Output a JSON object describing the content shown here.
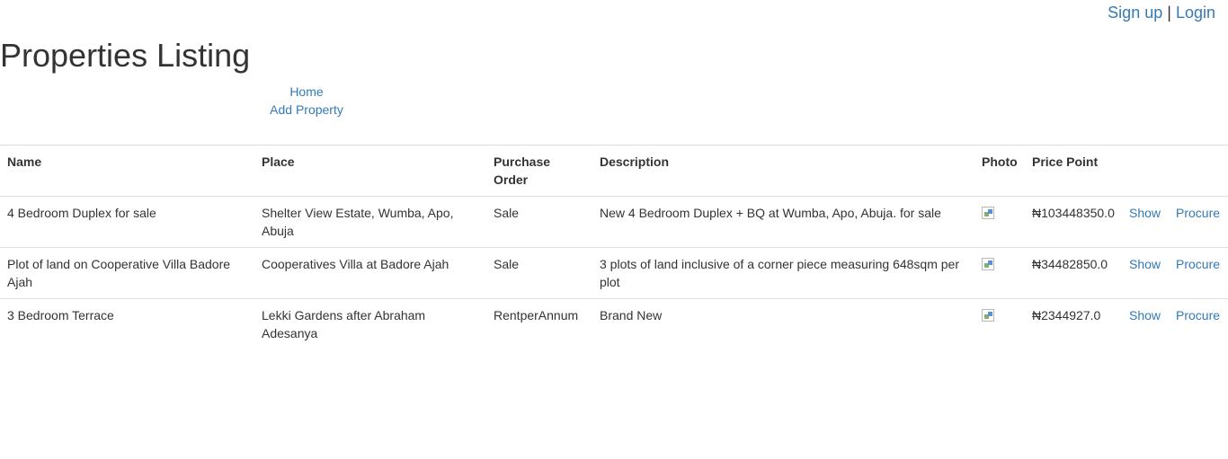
{
  "auth": {
    "signup": "Sign up",
    "separator": "|",
    "login": "Login"
  },
  "page_title": "Properties Listing",
  "nav": {
    "home": "Home",
    "add_property": "Add Property"
  },
  "table": {
    "headers": {
      "name": "Name",
      "place": "Place",
      "purchase_order": "Purchase Order",
      "description": "Description",
      "photo": "Photo",
      "price_point": "Price Point"
    },
    "rows": [
      {
        "name": "4 Bedroom Duplex for sale",
        "place": "Shelter View Estate, Wumba, Apo, Abuja",
        "purchase_order": "Sale",
        "description": "New 4 Bedroom Duplex + BQ at Wumba, Apo, Abuja. for sale",
        "photo_icon": "broken-image-icon",
        "price": "₦103448350.0",
        "show": "Show",
        "procure": "Procure"
      },
      {
        "name": "Plot of land on Cooperative Villa Badore Ajah",
        "place": "Cooperatives Villa at Badore Ajah",
        "purchase_order": "Sale",
        "description": "3 plots of land inclusive of a corner piece measuring 648sqm per plot",
        "photo_icon": "broken-image-icon",
        "price": "₦34482850.0",
        "show": "Show",
        "procure": "Procure"
      },
      {
        "name": "3 Bedroom Terrace",
        "place": "Lekki Gardens after Abraham Adesanya",
        "purchase_order": "RentperAnnum",
        "description": "Brand New",
        "photo_icon": "broken-image-icon",
        "price": "₦2344927.0",
        "show": "Show",
        "procure": "Procure"
      }
    ]
  },
  "colors": {
    "link": "#337ab7",
    "text": "#333333",
    "border": "#dddddd"
  }
}
